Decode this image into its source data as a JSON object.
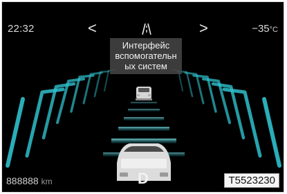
{
  "status_bar": {
    "time": "22:32",
    "temperature": "−35",
    "temperature_unit": "°C",
    "prev_label": "<",
    "next_label": ">"
  },
  "tooltip": {
    "lines": [
      "Интерфейс",
      "вспомогательн",
      "ых систем"
    ]
  },
  "footer": {
    "odometer_value": "888888",
    "odometer_unit": "km",
    "gear": "D",
    "code": "T5523230"
  },
  "colors": {
    "background": "#000000",
    "accent": "#39c9d6",
    "text": "#d9d9d9",
    "code_box_bg": "#f5f5f5"
  },
  "icons": [
    "chevron-left-icon",
    "lane-assist-icon",
    "chevron-right-icon",
    "lead-car-icon",
    "ego-car-icon"
  ]
}
